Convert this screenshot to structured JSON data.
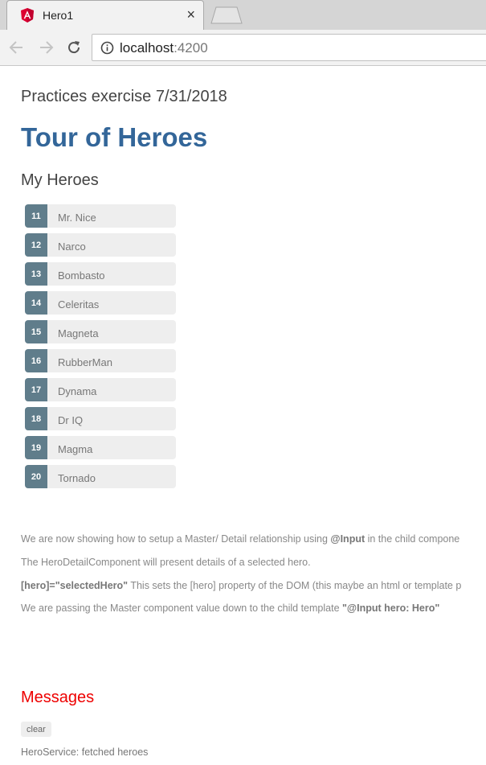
{
  "browser": {
    "tab_title": "Hero1",
    "tab_close": "×",
    "url_host": "localhost",
    "url_port": ":4200"
  },
  "page": {
    "practice": "Practices exercise 7/31/2018",
    "title": "Tour of Heroes",
    "subtitle": "My Heroes",
    "heroes": [
      {
        "id": "11",
        "name": "Mr. Nice"
      },
      {
        "id": "12",
        "name": "Narco"
      },
      {
        "id": "13",
        "name": "Bombasto"
      },
      {
        "id": "14",
        "name": "Celeritas"
      },
      {
        "id": "15",
        "name": "Magneta"
      },
      {
        "id": "16",
        "name": "RubberMan"
      },
      {
        "id": "17",
        "name": "Dynama"
      },
      {
        "id": "18",
        "name": "Dr IQ"
      },
      {
        "id": "19",
        "name": "Magma"
      },
      {
        "id": "20",
        "name": "Tornado"
      }
    ],
    "paragraphs": {
      "p1_a": "We are now showing how to setup a Master/ Detail relationship using ",
      "p1_b": "@Input",
      "p1_c": " in the child compone",
      "p2": "The HeroDetailComponent will present details of a selected hero.",
      "p3_a": "[hero]=\"selectedHero\"",
      "p3_b": " This sets the [hero] property of the DOM (this maybe an html or template p",
      "p4_a": "We are passing the Master component value down to the child template ",
      "p4_b": "\"@Input hero: Hero\""
    },
    "messages_title": "Messages",
    "clear_label": "clear",
    "message": "HeroService: fetched heroes"
  },
  "colors": {
    "title": "#336699",
    "badge": "#607d8b",
    "messages": "#ee0000"
  }
}
